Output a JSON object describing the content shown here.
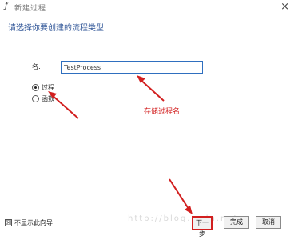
{
  "window": {
    "title": "新建过程"
  },
  "heading": "请选择你要创建的流程类型",
  "form": {
    "name_label": "名:",
    "name_value": "TestProcess"
  },
  "radios": [
    {
      "label": "过程",
      "checked": true
    },
    {
      "label": "函数",
      "checked": false
    }
  ],
  "annotation": "存储过程名",
  "footer": {
    "checkbox_label": "不显示此向导",
    "next": "下一步",
    "finish": "完成",
    "cancel": "取消"
  },
  "watermark": "http://blog.csdn.net",
  "colors": {
    "accent": "#2f5597",
    "annotation": "#d21f1f"
  }
}
